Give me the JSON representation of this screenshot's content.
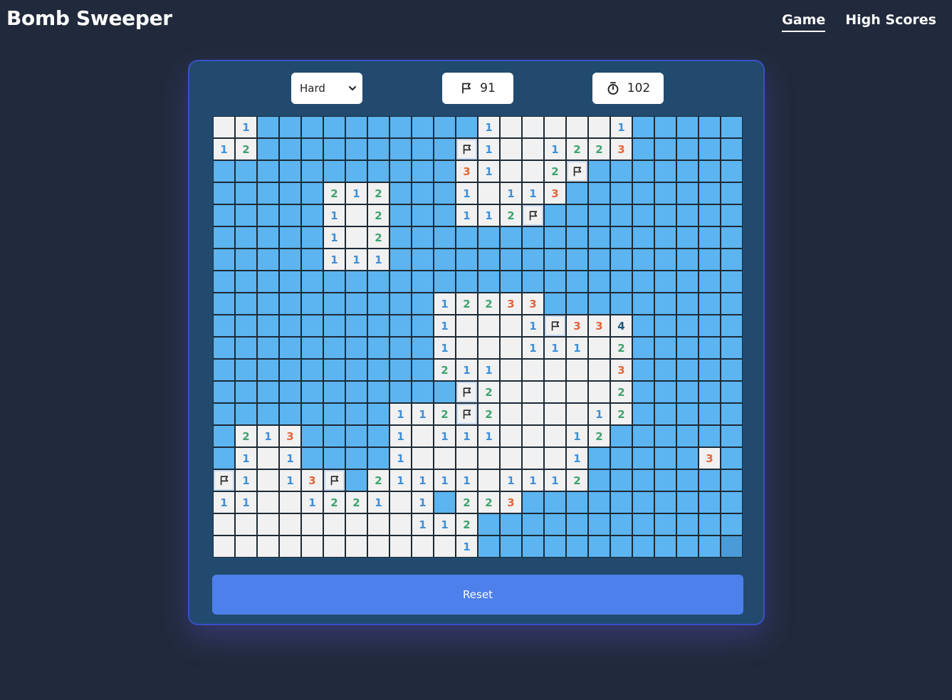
{
  "app": {
    "title": "Bomb Sweeper"
  },
  "nav": [
    {
      "label": "Game",
      "active": true
    },
    {
      "label": "High Scores",
      "active": false
    }
  ],
  "controls": {
    "difficulty": "Hard",
    "flags_remaining": "91",
    "time": "102",
    "reset_label": "Reset"
  },
  "board": {
    "rows": 20,
    "cols": 24,
    "legend": {
      "#": "hidden cell",
      "h": "hidden cell (hovered)",
      ".": "revealed empty cell",
      "F": "flagged cell",
      "1-8": "revealed number"
    },
    "grid": [
      ".1##########1.....1#####",
      "12#########F1..1223#####",
      "###########31..2F#######",
      "#####212###1.113########",
      "#####1.2###112F#########",
      "#####1.2################",
      "#####111################",
      "########################",
      "##########12233#########",
      "##########1...1F334#####",
      "##########1...111.2#####",
      "##########211.....3#####",
      "###########F2.....2#####",
      "########112F2....12#####",
      "#213####1.111...12######",
      "#1.1####1.......1#####3#",
      "F1.13F#21111.1112#######",
      "11..1221.1#223##########",
      ".........112############",
      "...........1###########h"
    ]
  }
}
